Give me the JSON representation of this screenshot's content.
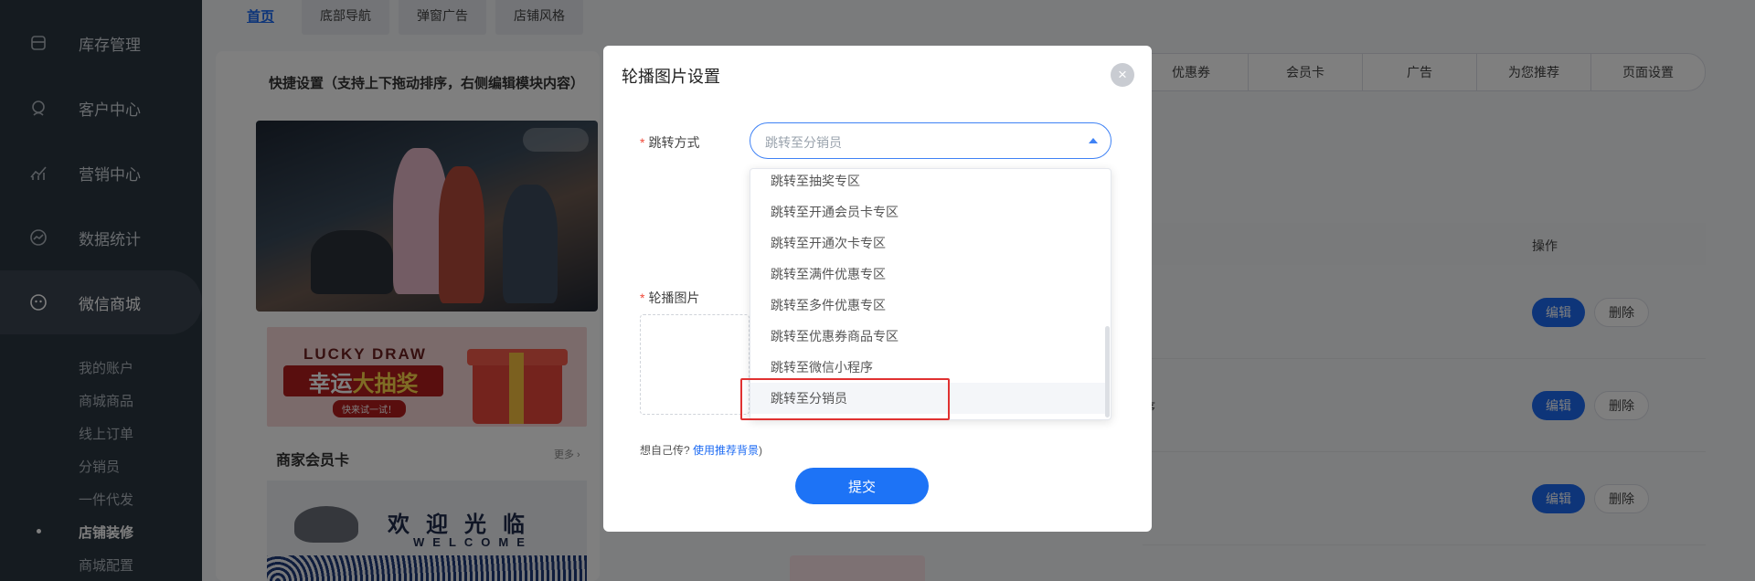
{
  "sidebar": {
    "items": [
      {
        "label": "库存管理",
        "icon": "inventory-icon"
      },
      {
        "label": "客户中心",
        "icon": "customer-icon"
      },
      {
        "label": "营销中心",
        "icon": "marketing-icon"
      },
      {
        "label": "数据统计",
        "icon": "chart-icon"
      },
      {
        "label": "微信商城",
        "icon": "wechat-icon"
      }
    ],
    "sub_items": [
      "我的账户",
      "商城商品",
      "线上订单",
      "分销员",
      "一件代发",
      "店铺装修",
      "商城配置"
    ]
  },
  "top_tabs": [
    "首页",
    "底部导航",
    "弹窗广告",
    "店铺风格"
  ],
  "quick_settings": {
    "title": "快捷设置（支持上下拖动排序，右侧编辑模块内容）",
    "lucky_draw": {
      "en": "LUCKY DRAW",
      "cn_a": "幸运",
      "cn_b": "大抽奖",
      "sub": "快来试一试！"
    },
    "member_card_title": "商家会员卡",
    "more": "更多 ›",
    "welcome": {
      "cn": "欢迎光临",
      "en": "WELCOME"
    }
  },
  "right_tabs": [
    "优惠券",
    "会员卡",
    "广告",
    "为您推荐",
    "页面设置"
  ],
  "table": {
    "op_header": "操作",
    "edit_label": "编辑",
    "delete_label": "删除",
    "row_text": "序"
  },
  "modal": {
    "title": "轮播图片设置",
    "close": "×",
    "jump_label": "跳转方式",
    "select_value": "跳转至分销员",
    "options": [
      "跳转至抽奖专区",
      "跳转至开通会员卡专区",
      "跳转至开通次卡专区",
      "跳转至满件优惠专区",
      "跳转至多件优惠专区",
      "跳转至优惠券商品专区",
      "跳转至微信小程序",
      "跳转至分销员"
    ],
    "image_label": "轮播图片",
    "hint_text": "想自己传?",
    "hint_link": "使用推荐背景",
    "hint_close": ")",
    "submit": "提交"
  }
}
